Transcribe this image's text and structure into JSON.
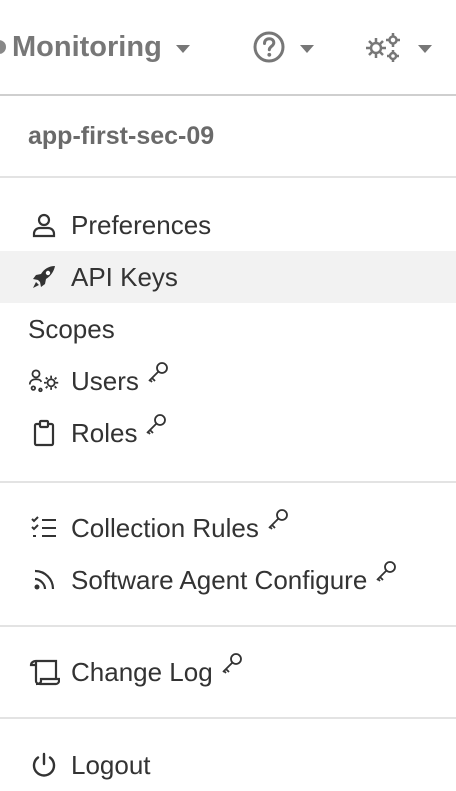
{
  "topbar": {
    "brand_label": "Monitoring",
    "help_icon": "question-circle-icon",
    "settings_icon": "gears-icon",
    "caret_icon": "caret-down-icon"
  },
  "menu": {
    "username": "app-first-sec-09",
    "links": [
      {
        "label": "Preferences",
        "icon": "user-icon",
        "admin": false
      },
      {
        "label": "API Keys",
        "icon": "rocket-icon",
        "admin": false,
        "active": true
      },
      {
        "label": "Scopes",
        "icon": "",
        "admin": false
      },
      {
        "label": "Users",
        "icon": "users-gear-icon",
        "admin": true
      },
      {
        "label": "Roles",
        "icon": "clipboard-icon",
        "admin": true
      }
    ],
    "config": [
      {
        "label": "Collection Rules",
        "icon": "list-check-icon",
        "admin": true
      },
      {
        "label": "Software Agent Configure",
        "icon": "rss-icon",
        "admin": true
      }
    ],
    "changelog": {
      "label": "Change Log",
      "icon": "scroll-icon",
      "admin": true
    },
    "logout": {
      "label": "Logout",
      "icon": "power-icon"
    }
  },
  "colors": {
    "active_row": "#f2f2f2",
    "divider": "#e3e3e3",
    "muted_text": "#777777"
  }
}
